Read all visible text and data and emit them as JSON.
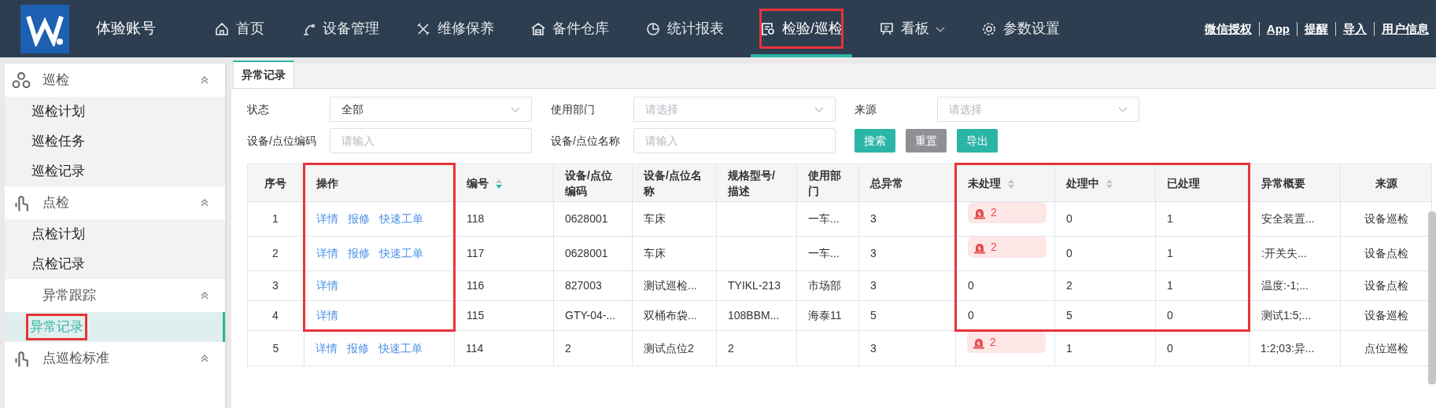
{
  "header": {
    "account": "体验账号",
    "nav": [
      {
        "label": "首页",
        "selected": false,
        "highlighted": false,
        "has_dropdown": false
      },
      {
        "label": "设备管理",
        "selected": false,
        "highlighted": false,
        "has_dropdown": false
      },
      {
        "label": "维修保养",
        "selected": false,
        "highlighted": false,
        "has_dropdown": false
      },
      {
        "label": "备件仓库",
        "selected": false,
        "highlighted": false,
        "has_dropdown": false
      },
      {
        "label": "统计报表",
        "selected": false,
        "highlighted": false,
        "has_dropdown": false
      },
      {
        "label": "检验/巡检",
        "selected": true,
        "highlighted": true,
        "has_dropdown": false
      },
      {
        "label": "看板",
        "selected": false,
        "highlighted": false,
        "has_dropdown": true
      },
      {
        "label": "参数设置",
        "selected": false,
        "highlighted": false,
        "has_dropdown": false
      }
    ],
    "links": [
      "微信授权",
      "App",
      "提醒",
      "导入",
      "用户信息"
    ]
  },
  "sidebar": [
    {
      "title": "巡检",
      "expanded": true,
      "children": [
        {
          "label": "巡检计划",
          "selected": false,
          "highlighted": false
        },
        {
          "label": "巡检任务",
          "selected": false,
          "highlighted": false
        },
        {
          "label": "巡检记录",
          "selected": false,
          "highlighted": false
        }
      ]
    },
    {
      "title": "点检",
      "expanded": true,
      "children": [
        {
          "label": "点检计划",
          "selected": false,
          "highlighted": false
        },
        {
          "label": "点检记录",
          "selected": false,
          "highlighted": false
        }
      ]
    },
    {
      "title": "异常跟踪",
      "expanded": true,
      "children": [
        {
          "label": "异常记录",
          "selected": true,
          "highlighted": true
        }
      ]
    },
    {
      "title": "点巡检标准",
      "expanded": true
    }
  ],
  "tabs": [
    {
      "label": "异常记录",
      "selected": true
    }
  ],
  "filters": [
    {
      "kind": "select",
      "label": "状态",
      "value": "全部"
    },
    {
      "kind": "select",
      "label": "使用部门",
      "placeholder": "请选择"
    },
    {
      "kind": "select",
      "label": "来源",
      "placeholder": "请选择"
    },
    {
      "kind": "input",
      "label": "设备/点位编码",
      "placeholder": "请输入"
    },
    {
      "kind": "input",
      "label": "设备/点位名称",
      "placeholder": "请输入"
    }
  ],
  "buttons": [
    {
      "label": "搜索",
      "kind": "primary"
    },
    {
      "label": "重置",
      "kind": "secondary"
    },
    {
      "label": "导出",
      "kind": "primary"
    }
  ],
  "table": {
    "columns": [
      {
        "label": "序号",
        "highlighted": false
      },
      {
        "label": "操作",
        "highlighted": true
      },
      {
        "label": "编号",
        "highlighted": false,
        "sortable": true,
        "sorted_desc": true
      },
      {
        "label": "设备/点位编码",
        "highlighted": false
      },
      {
        "label": "设备/点位名称",
        "highlighted": false
      },
      {
        "label": "规格型号/描述",
        "highlighted": false
      },
      {
        "label": "使用部门",
        "highlighted": false
      },
      {
        "label": "总异常",
        "highlighted": false
      },
      {
        "label": "未处理",
        "highlighted": true,
        "sortable": true,
        "sorted_desc": false
      },
      {
        "label": "处理中",
        "highlighted": true,
        "sortable": true,
        "sorted_desc": false
      },
      {
        "label": "已处理",
        "highlighted": true
      },
      {
        "label": "异常概要",
        "highlighted": false
      },
      {
        "label": "来源",
        "highlighted": false
      }
    ],
    "rows": [
      {
        "highlighted": true,
        "alert": true,
        "actions": [
          "详情",
          "报修",
          "快速工单"
        ],
        "cells": [
          "1",
          "",
          "118",
          "0628001",
          "车床",
          "",
          "一车...",
          "3",
          "2",
          "0",
          "1",
          "安全装置...",
          "设备巡检"
        ]
      },
      {
        "highlighted": true,
        "alert": true,
        "actions": [
          "详情",
          "报修",
          "快速工单"
        ],
        "cells": [
          "2",
          "",
          "117",
          "0628001",
          "车床",
          "",
          "一车...",
          "3",
          "2",
          "0",
          "1",
          ":开关失...",
          "设备点检"
        ]
      },
      {
        "highlighted": true,
        "alert": false,
        "actions": [
          "详情"
        ],
        "cells": [
          "3",
          "",
          "116",
          "827003",
          "测试巡检...",
          "TYIKL-213",
          "市场部",
          "3",
          "0",
          "2",
          "1",
          "温度:-1;...",
          "设备点检"
        ]
      },
      {
        "highlighted": true,
        "alert": false,
        "actions": [
          "详情"
        ],
        "cells": [
          "4",
          "",
          "115",
          "GTY-04-...",
          "双桶布袋...",
          "108BBM...",
          "海泰11",
          "5",
          "0",
          "5",
          "0",
          "测试1:5;...",
          "设备巡检"
        ]
      },
      {
        "highlighted": false,
        "alert": true,
        "actions": [
          "详情",
          "报修",
          "快速工单"
        ],
        "cells": [
          "5",
          "",
          "114",
          "2",
          "测试点位2",
          "2",
          "",
          "3",
          "2",
          "1",
          "0",
          "1:2;03:异...",
          "点位巡检"
        ]
      }
    ]
  }
}
